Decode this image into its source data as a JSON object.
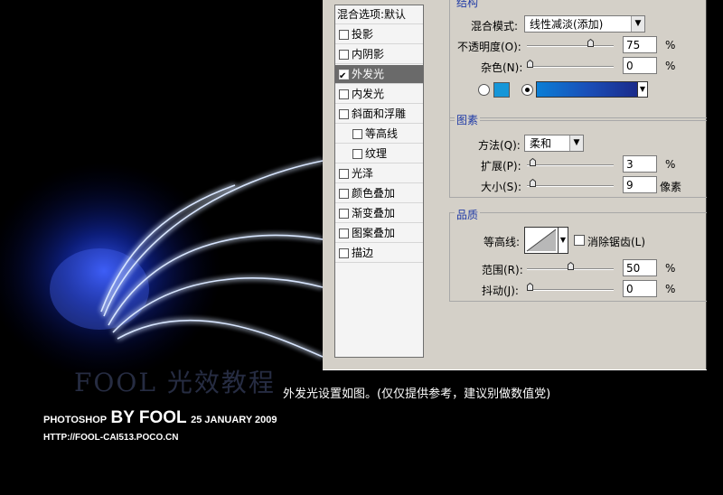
{
  "styles_panel": {
    "header": "混合选项:默认",
    "items": [
      {
        "label": "投影",
        "checked": false,
        "selected": false,
        "indent": false
      },
      {
        "label": "内阴影",
        "checked": false,
        "selected": false,
        "indent": false
      },
      {
        "label": "外发光",
        "checked": true,
        "selected": true,
        "indent": false
      },
      {
        "label": "内发光",
        "checked": false,
        "selected": false,
        "indent": false
      },
      {
        "label": "斜面和浮雕",
        "checked": false,
        "selected": false,
        "indent": false
      },
      {
        "label": "等高线",
        "checked": false,
        "selected": false,
        "indent": true
      },
      {
        "label": "纹理",
        "checked": false,
        "selected": false,
        "indent": true
      },
      {
        "label": "光泽",
        "checked": false,
        "selected": false,
        "indent": false
      },
      {
        "label": "颜色叠加",
        "checked": false,
        "selected": false,
        "indent": false
      },
      {
        "label": "渐变叠加",
        "checked": false,
        "selected": false,
        "indent": false
      },
      {
        "label": "图案叠加",
        "checked": false,
        "selected": false,
        "indent": false
      },
      {
        "label": "描边",
        "checked": false,
        "selected": false,
        "indent": false
      }
    ]
  },
  "structure": {
    "title": "结构",
    "blend_mode_label": "混合模式:",
    "blend_mode_value": "线性减淡(添加)",
    "opacity_label": "不透明度(O):",
    "opacity_value": "75",
    "opacity_fraction": 0.75,
    "noise_label": "杂色(N):",
    "noise_value": "0",
    "noise_fraction": 0,
    "percent": "%",
    "color_swatch": "#1596d8",
    "gradient_colors": [
      "#0a7ed6",
      "#1a4fb8",
      "#1a2a8a"
    ]
  },
  "elements": {
    "title": "图素",
    "technique_label": "方法(Q):",
    "technique_value": "柔和",
    "spread_label": "扩展(P):",
    "spread_value": "3",
    "spread_fraction": 0.03,
    "size_label": "大小(S):",
    "size_value": "9",
    "size_fraction": 0.036,
    "pixels": "像素",
    "percent": "%"
  },
  "quality": {
    "title": "品质",
    "contour_label": "等高线:",
    "anti_alias_label": "消除锯齿(L)",
    "anti_alias_checked": false,
    "range_label": "范围(R):",
    "range_value": "50",
    "range_fraction": 0.5,
    "jitter_label": "抖动(J):",
    "jitter_value": "0",
    "jitter_fraction": 0,
    "percent": "%"
  },
  "caption": "外发光设置如图。(仅仅提供参考，建议别做数值党)",
  "watermark": "FOOL 光效教程",
  "credit": {
    "prefix": "PHOTOSHOP",
    "by": "BY FOOL",
    "date": "25 JANUARY 2009",
    "url": "HTTP://FOOL-CAI513.POCO.CN"
  }
}
